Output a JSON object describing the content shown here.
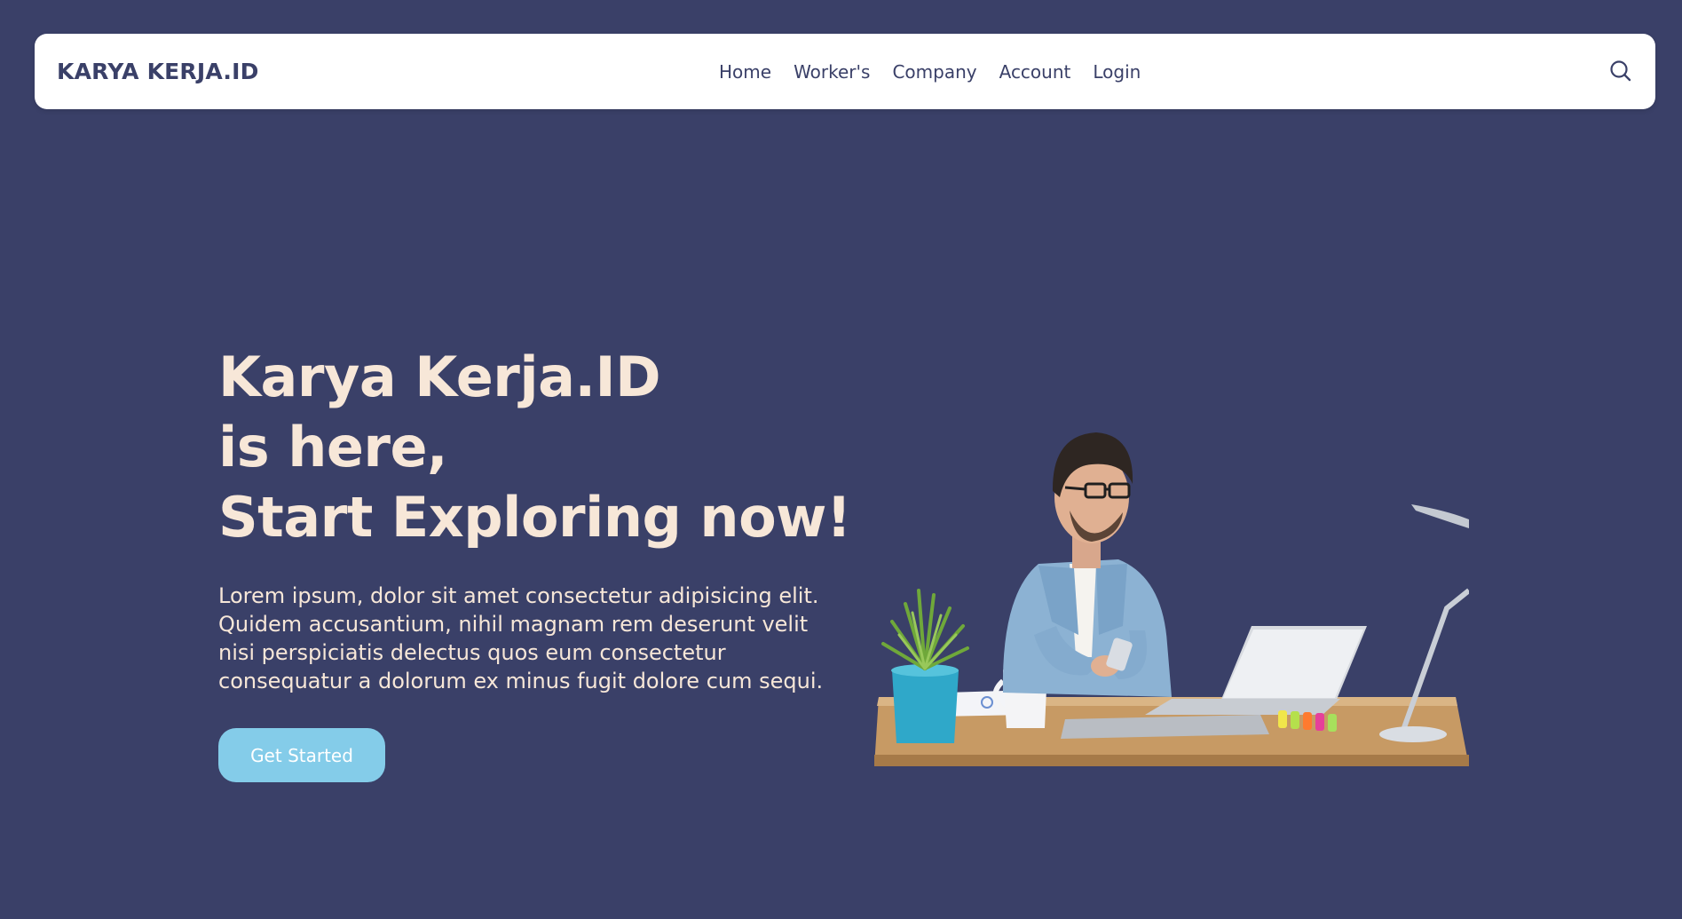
{
  "navbar": {
    "brand": "KARYA KERJA.ID",
    "links": [
      "Home",
      "Worker's",
      "Company",
      "Account",
      "Login"
    ],
    "search_icon": "search-icon"
  },
  "hero": {
    "title_lines": [
      "Karya Kerja.ID",
      "is here,",
      "Start Exploring now!"
    ],
    "description": "Lorem ipsum, dolor sit amet consectetur adipisicing elit. Quidem accusantium, nihil magnam rem deserunt velit nisi perspiciatis delectus quos eum consectetur consequatur a dolorum ex minus fugit dolore cum sequi.",
    "cta_label": "Get Started",
    "image": "man-working-at-desk-illustration"
  },
  "colors": {
    "background": "#3a4068",
    "navbar": "#ffffff",
    "heading_text": "#f7e7d8",
    "button": "#84cce9",
    "nav_text": "#3a4068"
  }
}
